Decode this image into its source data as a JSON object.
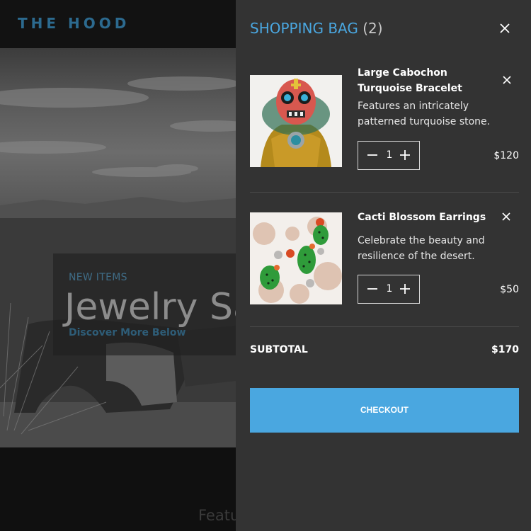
{
  "site": {
    "logo": "THE HOOD",
    "hero": {
      "kicker": "NEW ITEMS",
      "title": "Jewelry Sale",
      "link": "Discover More Below"
    },
    "section_heading": "Featu"
  },
  "cart": {
    "title": "SHOPPING BAG",
    "count": "(2)",
    "items": [
      {
        "name": "Large Cabochon Turquoise Bracelet",
        "description": "Features an intricately patterned turquoise stone.",
        "quantity": "1",
        "price": "$120",
        "image_icon": "sugar-skull-figure-image"
      },
      {
        "name": "Cacti Blossom Earrings",
        "description": "Celebrate the beauty and resilience of the desert.",
        "quantity": "1",
        "price": "$50",
        "image_icon": "cactus-earrings-image"
      }
    ],
    "subtotal_label": "SUBTOTAL",
    "subtotal_value": "$170",
    "checkout_label": "CHECKOUT"
  },
  "colors": {
    "accent": "#4aa7e0",
    "drawer_bg": "#333333",
    "logo": "#2c6a8f"
  }
}
